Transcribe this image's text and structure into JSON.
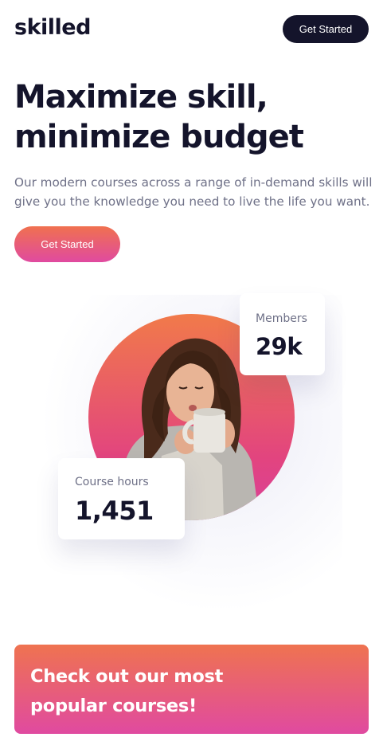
{
  "header": {
    "logo": "skilled",
    "cta_label": "Get Started"
  },
  "hero": {
    "title": "Maximize skill, minimize budget",
    "description": "Our modern courses across a range of in-demand skills will give you the knowledge you need to live the life you want.",
    "cta_label": "Get Started"
  },
  "stats": {
    "members_label": "Members",
    "members_value": "29k",
    "hours_label": "Course hours",
    "hours_value": "1,451"
  },
  "courses": {
    "title": "Check out our most popular courses!"
  },
  "colors": {
    "dark": "#14142b",
    "gradient_start": "#f0714f",
    "gradient_end": "#e04aa0",
    "text_muted": "#6e7087"
  }
}
